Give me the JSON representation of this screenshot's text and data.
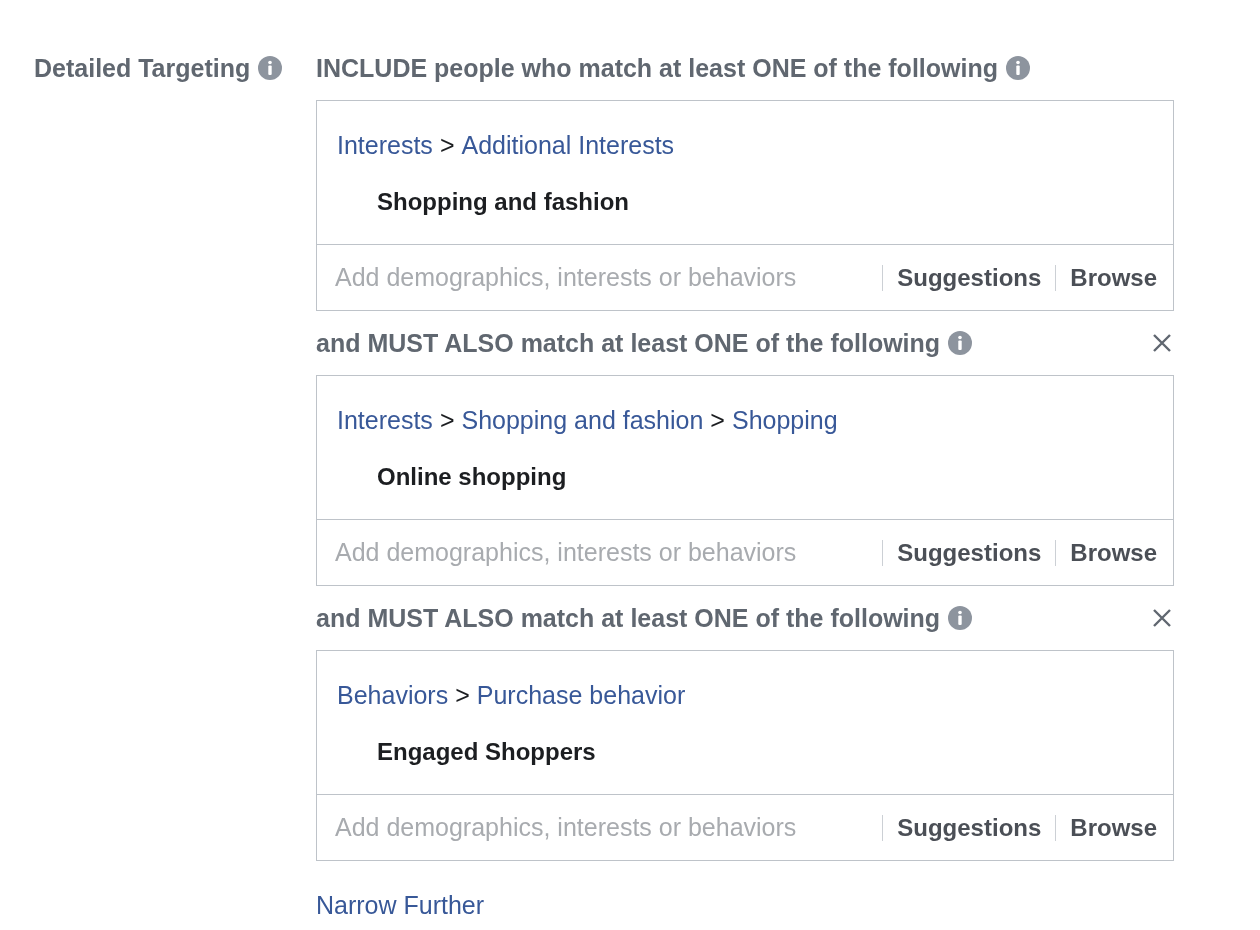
{
  "label": "Detailed Targeting",
  "groups": [
    {
      "heading": "INCLUDE people who match at least ONE of the following",
      "removable": false,
      "path": [
        {
          "kind": "link",
          "text": "Interests"
        },
        {
          "kind": "sep",
          "text": ">"
        },
        {
          "kind": "link",
          "text": "Additional Interests"
        }
      ],
      "items": [
        "Shopping and fashion"
      ],
      "placeholder": "Add demographics, interests or behaviors",
      "suggestions": "Suggestions",
      "browse": "Browse"
    },
    {
      "heading": "and MUST ALSO match at least ONE of the following",
      "removable": true,
      "path": [
        {
          "kind": "link",
          "text": "Interests"
        },
        {
          "kind": "sep",
          "text": ">"
        },
        {
          "kind": "link",
          "text": "Shopping and fashion"
        },
        {
          "kind": "sep",
          "text": ">"
        },
        {
          "kind": "link",
          "text": "Shopping"
        }
      ],
      "items": [
        "Online shopping"
      ],
      "placeholder": "Add demographics, interests or behaviors",
      "suggestions": "Suggestions",
      "browse": "Browse"
    },
    {
      "heading": "and MUST ALSO match at least ONE of the following",
      "removable": true,
      "path": [
        {
          "kind": "link",
          "text": "Behaviors"
        },
        {
          "kind": "sep",
          "text": ">"
        },
        {
          "kind": "link",
          "text": "Purchase behavior"
        }
      ],
      "items": [
        "Engaged Shoppers"
      ],
      "placeholder": "Add demographics, interests or behaviors",
      "suggestions": "Suggestions",
      "browse": "Browse"
    }
  ],
  "footer_link": "Narrow Further"
}
